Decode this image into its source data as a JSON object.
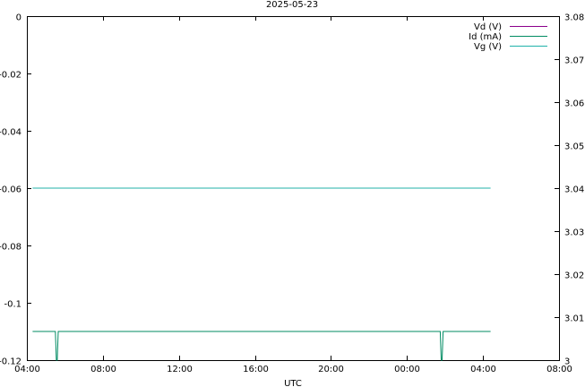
{
  "chart_data": {
    "type": "line",
    "title": "2025-05-23",
    "xlabel": "UTC",
    "ylabel_left": "",
    "ylabel_right": "",
    "x_ticks": [
      "04:00",
      "08:00",
      "12:00",
      "16:00",
      "20:00",
      "00:00",
      "04:00",
      "08:00"
    ],
    "x_range_hours": [
      0,
      28
    ],
    "ylim_left": [
      -0.12,
      0
    ],
    "y_ticks_left": [
      "0",
      "-0.02",
      "-0.04",
      "-0.06",
      "-0.08",
      "-0.1",
      "-0.12"
    ],
    "y_ticks_left_values": [
      0,
      -0.02,
      -0.04,
      -0.06,
      -0.08,
      -0.1,
      -0.12
    ],
    "ylim_right": [
      3.0,
      3.08
    ],
    "y_ticks_right": [
      "3.08",
      "3.07",
      "3.06",
      "3.05",
      "3.04",
      "3.03",
      "3.02",
      "3.01",
      "3"
    ],
    "y_ticks_right_values": [
      3.08,
      3.07,
      3.06,
      3.05,
      3.04,
      3.03,
      3.02,
      3.01,
      3.0
    ],
    "legend_position": "top-right",
    "grid": false,
    "series": [
      {
        "name": "Vd (V)",
        "axis": "left",
        "color": "#8b008b",
        "x_hours": [],
        "values": []
      },
      {
        "name": "Id (mA)",
        "axis": "left",
        "color": "#008b62",
        "x_hours": [
          0.3,
          1.5,
          1.55,
          1.6,
          1.65,
          21.75,
          21.8,
          21.85,
          21.9,
          24.4
        ],
        "values": [
          -0.11,
          -0.11,
          -0.12,
          -0.12,
          -0.11,
          -0.11,
          -0.12,
          -0.12,
          -0.11,
          -0.11
        ]
      },
      {
        "name": "Vg (V)",
        "axis": "left",
        "color": "#20b2aa",
        "x_hours": [
          0.3,
          24.4
        ],
        "values": [
          -0.06,
          -0.06
        ]
      }
    ]
  }
}
